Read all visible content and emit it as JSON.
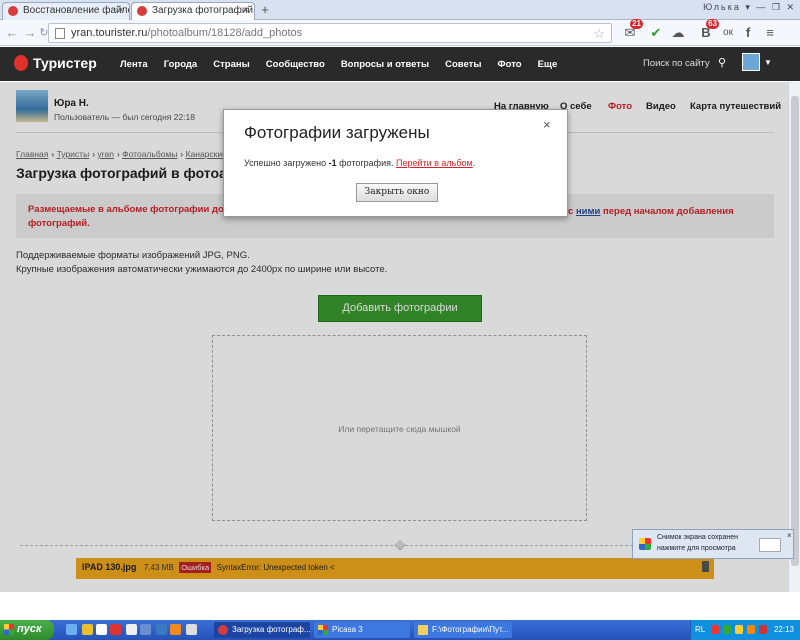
{
  "browser": {
    "tabs": [
      {
        "title": "Восстановление файлов",
        "close": "×"
      },
      {
        "title": "Загрузка фотографий",
        "close": "×"
      }
    ],
    "new_tab": "+",
    "window_user": "Юлька ▾",
    "window_controls": "— ❐ ✕",
    "url_host": "yran.tourister.ru",
    "url_path": "/photoalbum/18128/add_photos",
    "back": "←",
    "forward": "→",
    "reload": "↻",
    "bookmark_star": "☆",
    "extensions": [
      {
        "icon": "mail-icon",
        "glyph": "✉",
        "badge": "21"
      },
      {
        "icon": "shield-check-icon",
        "glyph": "✔",
        "badge": ""
      },
      {
        "icon": "chat-icon",
        "glyph": "☁",
        "badge": ""
      },
      {
        "icon": "vk-icon",
        "glyph": "В",
        "badge": "63"
      },
      {
        "icon": "odnoklassniki-icon",
        "glyph": "ок",
        "badge": ""
      },
      {
        "icon": "facebook-icon",
        "glyph": "f",
        "badge": ""
      },
      {
        "icon": "menu-icon",
        "glyph": "≡",
        "badge": ""
      }
    ]
  },
  "site": {
    "logo": "Туристер",
    "nav": [
      "Лента",
      "Города",
      "Страны",
      "Сообщество",
      "Вопросы и ответы",
      "Советы",
      "Фото",
      "Еще"
    ],
    "search_label": "Поиск по сайту",
    "search_icon": "search-icon"
  },
  "profile": {
    "name": "Юра Н.",
    "status": "Пользователь — был сегодня 22:18",
    "nav": [
      "На главную",
      "О себе",
      "Фото",
      "Видео",
      "Карта путешествий"
    ],
    "active_nav": "Фото"
  },
  "breadcrumb": [
    "Главная",
    "›",
    "Туристы",
    "›",
    "yran",
    "›",
    "Фотоальбомы",
    "›",
    "Канарские"
  ],
  "page_title": "Загрузка фотографий в фотоал",
  "warning": {
    "line1": "Размещаемые в альбоме фотографии дол",
    "line2": "фотографий.",
    "right_pre": "с ",
    "right_link": "ними",
    "right_post": " перед началом добавления"
  },
  "info": {
    "formats": "Поддерживаемые форматы изображений JPG, PNG.",
    "resize": "Крупные изображения автоматически ужимаются до 2400px по ширине или высоте."
  },
  "add_button": "Добавить фотографии",
  "dropzone_text": "Или перетащите сюда мышкой",
  "file": {
    "name": "IPAD 130.jpg",
    "size": "7.43 MB",
    "badge": "Ошибка",
    "error": "SyntaxError: Unexpected token <"
  },
  "modal": {
    "title": "Фотографии загружены",
    "close": "×",
    "msg_pre": "Успешно загружено ",
    "msg_count": "-1",
    "msg_mid": " фотография. ",
    "msg_link": "Перейти в альбом",
    "msg_end": ".",
    "button": "Закрыть окно"
  },
  "notification": {
    "line1": "Снимок экрана сохранен",
    "line2": "нажмите для просмотра",
    "close": "×"
  },
  "taskbar": {
    "start": "пуск",
    "tasks": [
      {
        "label": "Загрузка фотограф...",
        "icon": "browser-icon"
      },
      {
        "label": "Picasa 3",
        "icon": "picasa-icon"
      },
      {
        "label": "F:\\Фотографии\\Пут...",
        "icon": "folder-icon"
      }
    ],
    "lang": "RL",
    "clock": "22:13"
  },
  "colors": {
    "accent": "#d6252b",
    "header_bg": "#2a2a2a",
    "add_button": "#3a9a2e",
    "file_row": "#f0a81d",
    "taskbar": "#2452b8"
  }
}
